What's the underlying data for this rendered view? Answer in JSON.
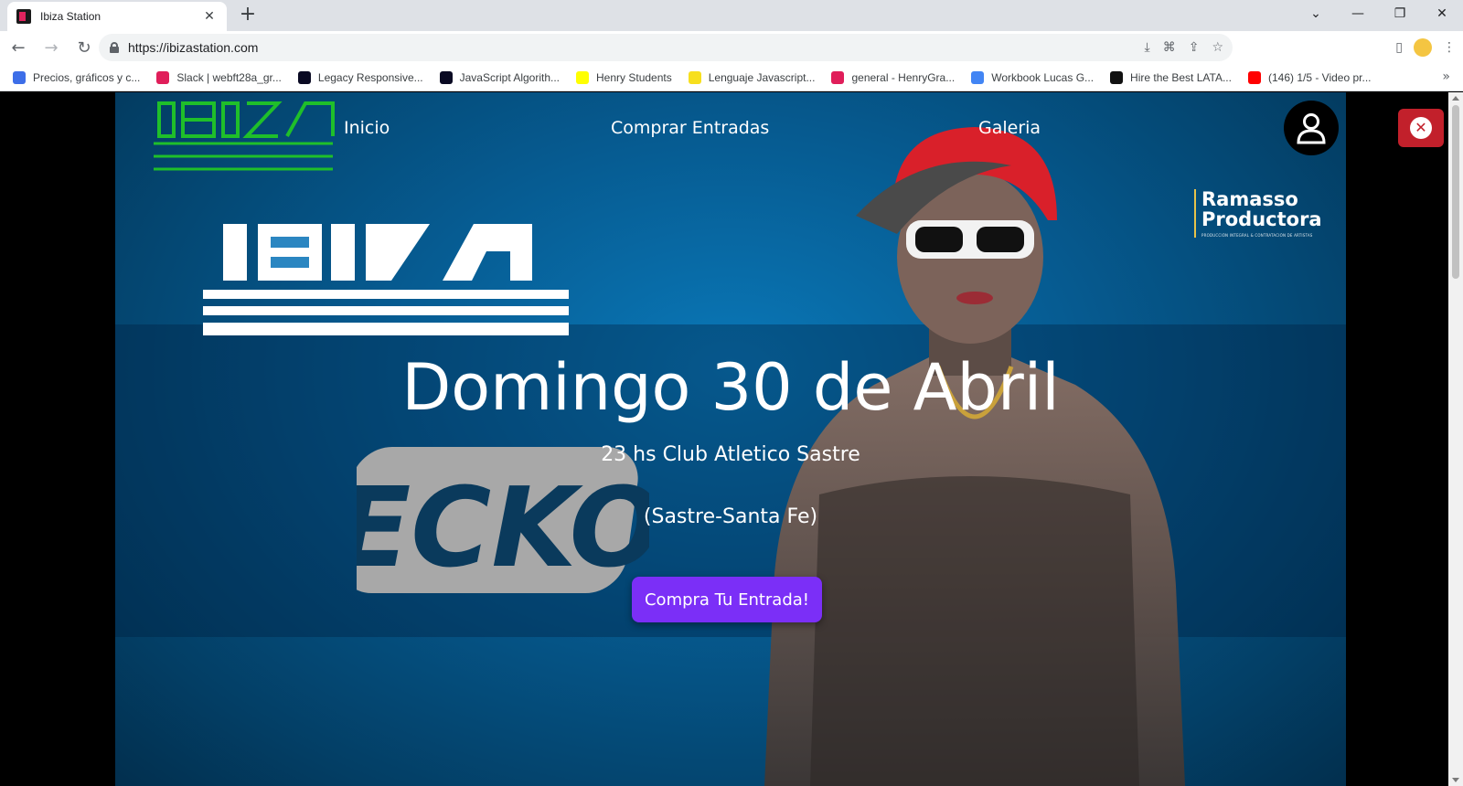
{
  "browser": {
    "tab_title": "Ibiza Station",
    "url": "https://ibizastation.com",
    "bookmarks": [
      {
        "label": "Precios, gráficos y c...",
        "color": "#3d6ee8"
      },
      {
        "label": "Slack | webft28a_gr...",
        "color": "#e01e5a"
      },
      {
        "label": "Legacy Responsive...",
        "color": "#0a0a23"
      },
      {
        "label": "JavaScript Algorith...",
        "color": "#0a0a23"
      },
      {
        "label": "Henry Students",
        "color": "#ffff01"
      },
      {
        "label": "Lenguaje Javascript...",
        "color": "#f7df1e"
      },
      {
        "label": "general - HenryGra...",
        "color": "#e01e5a"
      },
      {
        "label": "Workbook Lucas G...",
        "color": "#4285f4"
      },
      {
        "label": "Hire the Best LATA...",
        "color": "#111111"
      },
      {
        "label": "(146) 1/5 - Video pr...",
        "color": "#ff0000"
      }
    ]
  },
  "site": {
    "nav": {
      "inicio": "Inicio",
      "comprar": "Comprar Entradas",
      "galeria": "Galeria"
    },
    "producer": {
      "name_line1": "Ramasso",
      "name_line2": "Productora",
      "tagline": "PRODUCCIÓN INTEGRAL & CONTRATACIÓN DE ARTISTAS"
    },
    "artist": "ECKO",
    "event": {
      "date": "Domingo 30 de Abril",
      "time_venue": "23 hs Club Atletico Sastre",
      "location": "(Sastre-Santa Fe)",
      "cta": "Compra Tu Entrada!"
    },
    "colors": {
      "logo_green": "#1fbf2a",
      "cta_purple": "#7b2ff7",
      "close_red": "#c2202b",
      "hero_blue": "#065b91"
    }
  }
}
